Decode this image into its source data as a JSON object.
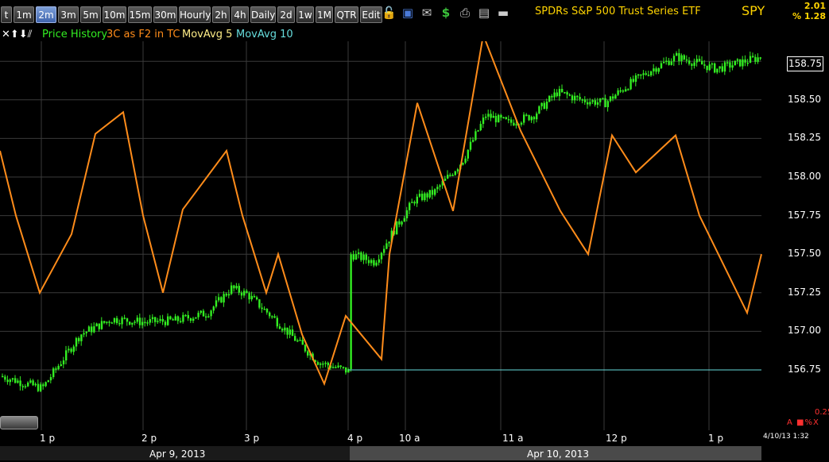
{
  "toolbar": {
    "intervals": [
      "t",
      "1m",
      "2m",
      "3m",
      "5m",
      "10m",
      "15m",
      "30m",
      "Hourly",
      "2h",
      "4h",
      "Daily",
      "2d",
      "1w",
      "1M",
      "QTR",
      "Edit"
    ],
    "active": "2m",
    "icons": [
      "lock-icon",
      "save-icon",
      "email-icon",
      "dollar-icon",
      "print-icon",
      "notes-icon",
      "minimize-icon"
    ]
  },
  "header": {
    "title": "SPDRs S&P 500 Trust Series ETF",
    "symbol": "SPY",
    "change": "2.01",
    "change_pct": "% 1.28"
  },
  "legend": {
    "controls": "✕⬆⬇⫽",
    "price_history": "Price History",
    "cmf": "3C as F2 in TC",
    "ma5": "MovAvg 5",
    "ma10": "MovAvg 10"
  },
  "colors": {
    "price": "#33ee22",
    "indicator": "#ff8c1a",
    "ma5": "#ffee88",
    "ma10": "#66dddd",
    "grid": "#3a3a3a"
  },
  "price_axis": {
    "current": "158.75",
    "labels": [
      "158.50",
      "158.25",
      "158.00",
      "157.75",
      "157.50",
      "157.25",
      "157.00",
      "156.75"
    ],
    "indicator_value": "0.25",
    "indicator_flags": "A ■%X"
  },
  "time_axis": {
    "labels": [
      "1 p",
      "2 p",
      "3 p",
      "4 p",
      "10 a",
      "11 a",
      "12 p",
      "1 p"
    ],
    "dates": [
      "Apr 9, 2013",
      "Apr 10, 2013"
    ],
    "timestamp": "4/10/13 1:32"
  },
  "chart_data": {
    "type": "line",
    "series": [
      {
        "name": "Price History",
        "x": [
          "12:35",
          "13:00",
          "13:20",
          "13:40",
          "14:00",
          "14:20",
          "14:40",
          "15:00",
          "15:15",
          "15:30",
          "15:45",
          "15:55",
          "16:00",
          "09:35",
          "09:45",
          "10:00",
          "10:15",
          "10:30",
          "10:45",
          "11:00",
          "11:15",
          "11:30",
          "11:45",
          "12:00",
          "12:15",
          "12:30",
          "12:45",
          "13:00",
          "13:15",
          "13:30"
        ],
        "values": [
          156.71,
          156.63,
          156.98,
          157.08,
          157.06,
          157.07,
          157.12,
          157.28,
          157.24,
          157.1,
          156.95,
          156.8,
          156.74,
          157.5,
          157.45,
          157.7,
          157.85,
          157.9,
          158.1,
          158.4,
          158.35,
          158.4,
          158.55,
          158.5,
          158.48,
          158.6,
          158.7,
          158.78,
          158.7,
          158.78
        ]
      },
      {
        "name": "3C as F2 in TC",
        "values": [
          158.17,
          157.75,
          157.5,
          157.25,
          157.63,
          158.28,
          158.42,
          157.75,
          157.25,
          157.79,
          158.17,
          157.75,
          157.25,
          157.5,
          156.98,
          156.66,
          157.1,
          156.82,
          157.5,
          158.48,
          157.78,
          158.92,
          158.3,
          157.78,
          157.5,
          158.27,
          158.03,
          158.27,
          157.75,
          157.12,
          157.5
        ],
        "xlabel": "",
        "ylabel": ""
      }
    ],
    "ylim": [
      156.5,
      159.0
    ],
    "grid": true
  }
}
